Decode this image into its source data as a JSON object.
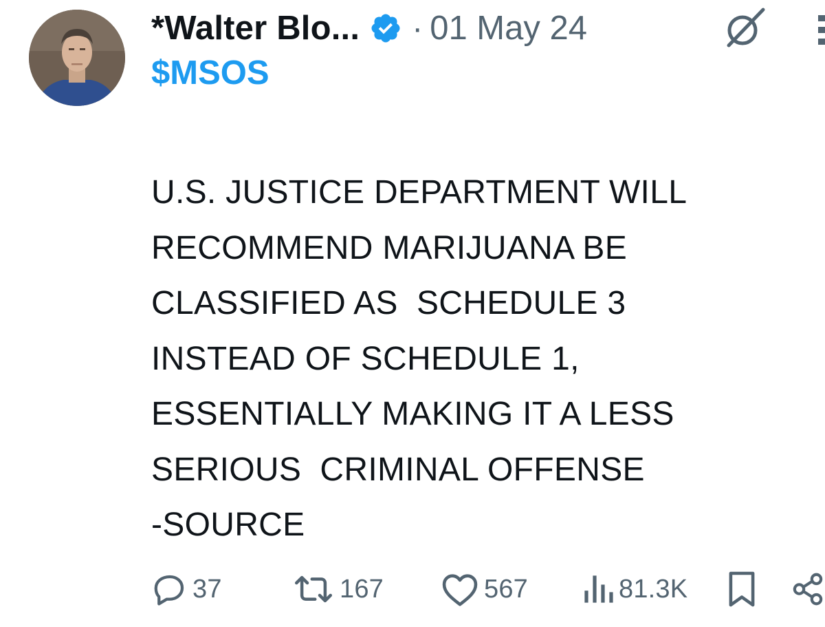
{
  "author": {
    "name": "*Walter Blo...",
    "verified": true,
    "verified_color": "#1d9bf0",
    "date_separator": "·",
    "date": "01 May 24"
  },
  "tweet": {
    "cashtag": "$MSOS",
    "cashtag_color": "#1d9bf0",
    "body_lines": [
      "U.S. JUSTICE DEPARTMENT WILL",
      "RECOMMEND MARIJUANA BE",
      "CLASSIFIED AS  SCHEDULE 3",
      "INSTEAD OF SCHEDULE 1,",
      "ESSENTIALLY MAKING IT A LESS",
      "SERIOUS  CRIMINAL OFFENSE",
      "-SOURCE"
    ]
  },
  "actions": {
    "replies": "37",
    "reposts": "167",
    "likes": "567",
    "views": "81.3K"
  },
  "icons": {
    "header": [
      "verified-badge-icon",
      "grok-icon",
      "more-icon"
    ],
    "actions": [
      "reply-icon",
      "repost-icon",
      "like-icon",
      "views-icon",
      "bookmark-icon",
      "share-icon"
    ]
  },
  "colors": {
    "text": "#0f1419",
    "muted": "#536471",
    "accent": "#1d9bf0"
  }
}
